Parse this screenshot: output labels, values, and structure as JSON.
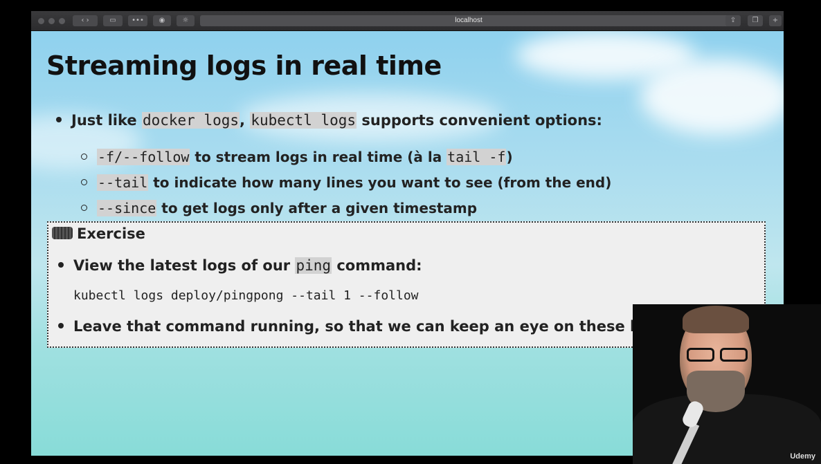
{
  "browser": {
    "url": "localhost"
  },
  "slide": {
    "title": "Streaming logs in real time",
    "intro": {
      "pre": "Just like ",
      "code1": "docker logs",
      "mid": ", ",
      "code2": "kubectl logs",
      "post": " supports convenient options:"
    },
    "options": [
      {
        "code": "-f/--follow",
        "text": " to stream logs in real time (à la ",
        "code2": "tail -f",
        "post": ")"
      },
      {
        "code": "--tail",
        "text": " to indicate how many lines you want to see (from the end)"
      },
      {
        "code": "--since",
        "text": " to get logs only after a given timestamp"
      }
    ],
    "exercise": {
      "title": "Exercise",
      "item1_pre": "View the latest logs of our ",
      "item1_code": "ping",
      "item1_post": " command:",
      "command": "kubectl logs deploy/pingpong --tail 1 --follow",
      "item2": "Leave that command running, so that we can keep an eye on these logs"
    }
  },
  "watermark": "Udemy"
}
